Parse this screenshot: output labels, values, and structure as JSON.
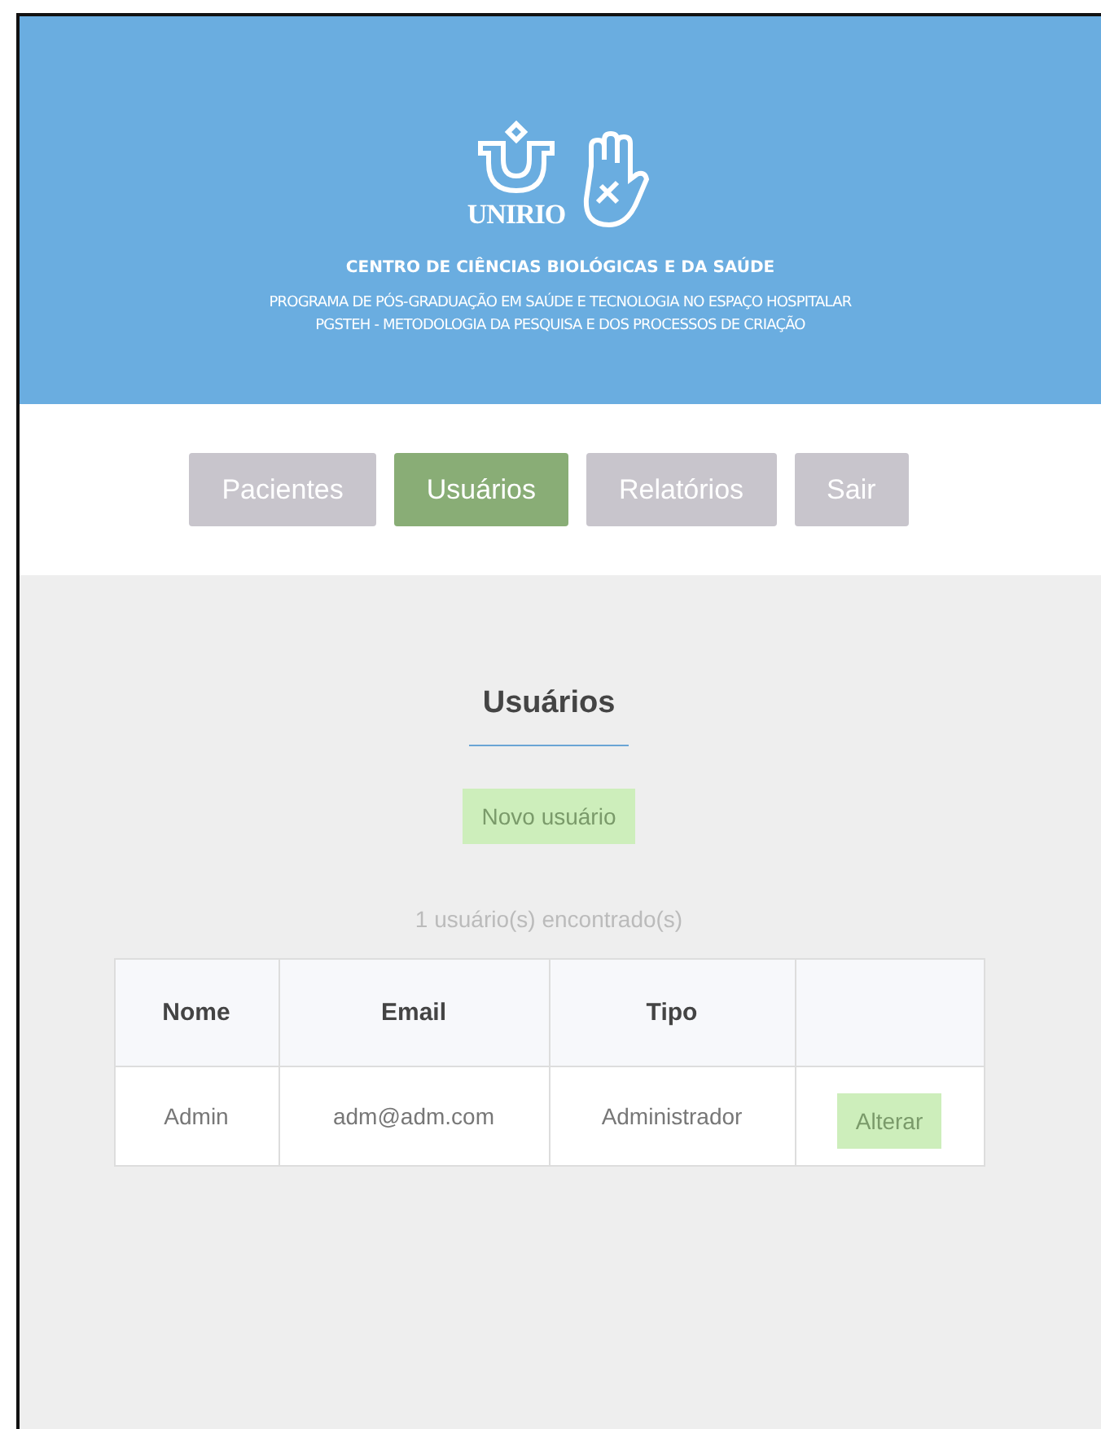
{
  "header": {
    "logo_text": "UNIRIO",
    "center": "CENTRO DE CIÊNCIAS BIOLÓGICAS E DA SAÚDE",
    "program_lines": [
      "PROGRAMA DE PÓS-GRADUAÇÃO EM SAÚDE E TECNOLOGIA NO ESPAÇO HOSPITALAR",
      "PGSTEH - METODOLOGIA DA PESQUISA E DOS PROCESSOS DE CRIAÇÃO"
    ]
  },
  "tabs": [
    {
      "label": "Pacientes",
      "selected": false
    },
    {
      "label": "Usuários",
      "selected": true
    },
    {
      "label": "Relatórios",
      "selected": false
    },
    {
      "label": "Sair",
      "selected": false
    }
  ],
  "page_title": "Usuários",
  "new_button": "Novo usuário",
  "count": "1 usuário(s) encontrado(s)",
  "table": {
    "columns": [
      "Nome",
      "Email",
      "Tipo"
    ],
    "rows": [
      {
        "cells": [
          "Admin",
          "adm@adm.com",
          "Administrador"
        ],
        "action": "Alterar"
      }
    ]
  }
}
